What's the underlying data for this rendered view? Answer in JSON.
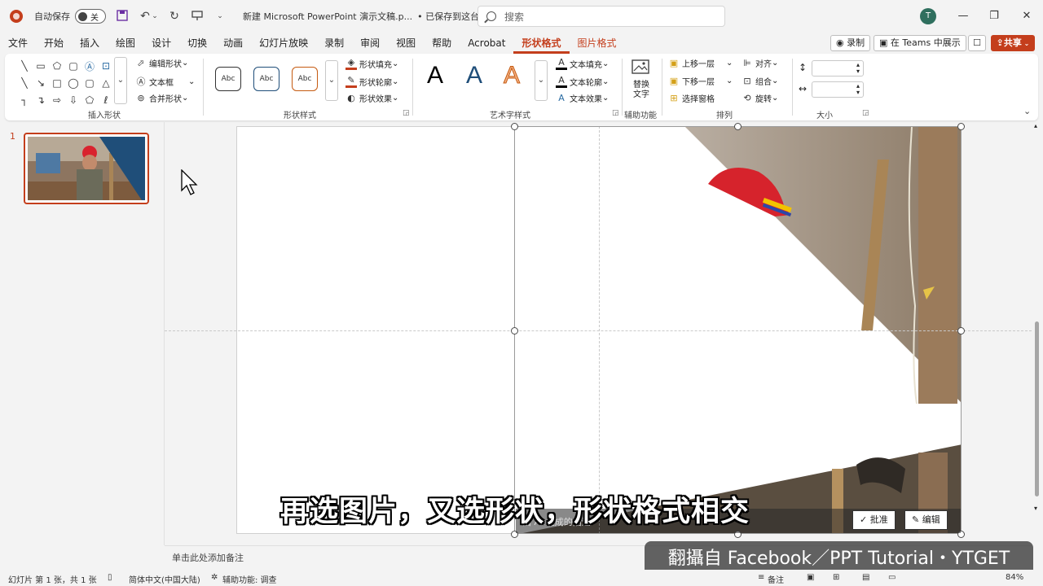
{
  "titlebar": {
    "autosave_label": "自动保存",
    "autosave_state": "关",
    "doc_title": "新建 Microsoft PowerPoint 演示文稿.p...",
    "save_status": "• 已保存到这台电脑",
    "search_placeholder": "搜索",
    "avatar_initial": "T"
  },
  "tabs": [
    "文件",
    "开始",
    "插入",
    "绘图",
    "设计",
    "切换",
    "动画",
    "幻灯片放映",
    "录制",
    "审阅",
    "视图",
    "帮助",
    "Acrobat",
    "形状格式",
    "图片格式"
  ],
  "active_tab": "形状格式",
  "tab_actions": {
    "record": "录制",
    "teams": "在 Teams 中展示",
    "share": "共享"
  },
  "ribbon": {
    "insert_shapes": {
      "label": "插入形状",
      "edit_shape": "编辑形状",
      "text_box": "文本框",
      "merge_shapes": "合并形状"
    },
    "shape_styles": {
      "label": "形状样式",
      "presets": [
        "Abc",
        "Abc",
        "Abc"
      ],
      "fill": "形状填充",
      "outline": "形状轮廓",
      "effects": "形状效果"
    },
    "wordart_styles": {
      "label": "艺术字样式",
      "presets": [
        "A",
        "A",
        "A"
      ],
      "text_fill": "文本填充",
      "text_outline": "文本轮廓",
      "text_effects": "文本效果"
    },
    "accessibility": {
      "label": "辅助功能",
      "alt_text_line1": "替换",
      "alt_text_line2": "文字"
    },
    "arrange": {
      "label": "排列",
      "bring_forward": "上移一层",
      "send_backward": "下移一层",
      "selection_pane": "选择窗格",
      "align": "对齐",
      "group": "组合",
      "rotate": "旋转"
    },
    "size": {
      "label": "大小"
    }
  },
  "thumbnails": {
    "slide_number": "1"
  },
  "slide": {
    "alt_text_hint": "由 AI 生成的描述",
    "approve_button": "批准",
    "edit_button": "编辑"
  },
  "subtitle": "再选图片，又选形状，形状格式相交",
  "notes_placeholder": "单击此处添加备注",
  "watermark": "翻攝自 Facebook／PPT Tutorial・YTGET",
  "status": {
    "slide_info": "幻灯片 第 1 张，共 1 张",
    "language": "简体中文(中国大陆)",
    "accessibility": "辅助功能: 调查",
    "notes": "备注",
    "zoom": "84%"
  },
  "colors": {
    "accent": "#c43e1c",
    "ribbon_bg": "#ffffff",
    "app_bg": "#f3f3f3"
  }
}
